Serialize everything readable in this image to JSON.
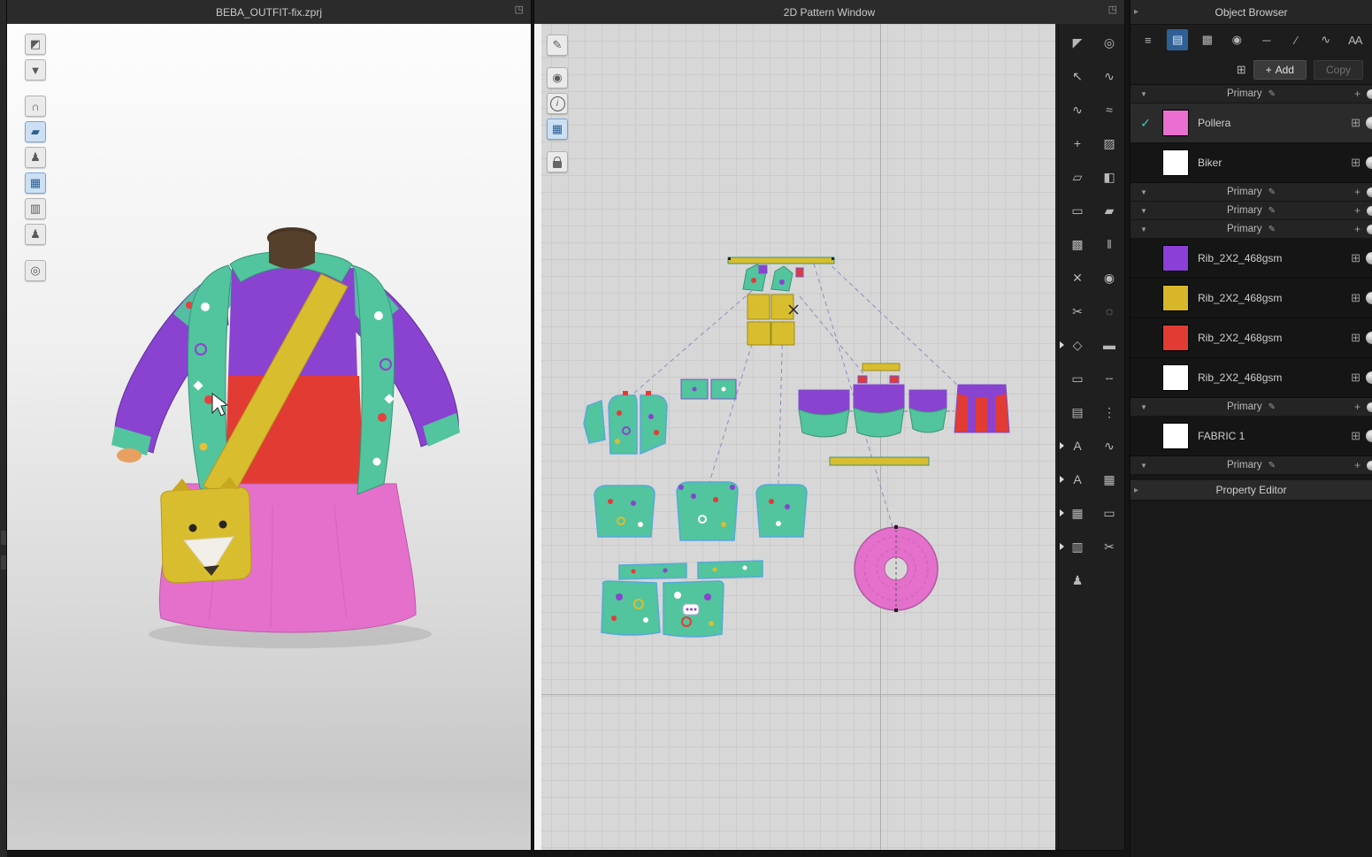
{
  "palette": {
    "pink": "#e470cc",
    "purple": "#8a42d0",
    "yellow": "#d8be2e",
    "red": "#e23b34",
    "teal": "#52c49e",
    "accent_blue": "#2e5f95"
  },
  "win3d": {
    "title": "BEBA_OUTFIT-fix.zprj"
  },
  "win2d": {
    "title": "2D Pattern Window"
  },
  "property_editor": {
    "title": "Property Editor"
  },
  "icons": {
    "popout": "◳",
    "panel_arrow": "▸",
    "check": "✓",
    "pencil": "✎",
    "collapse": "▼",
    "plus": "+",
    "boxed_plus": "⊞"
  },
  "toolbar3d": [
    {
      "name": "simulate",
      "glyph": "◩"
    },
    {
      "name": "garment-show",
      "glyph": "▼"
    },
    {
      "name": "hat-show",
      "glyph": "∩",
      "gap": true
    },
    {
      "name": "paint",
      "glyph": "▰",
      "active": true
    },
    {
      "name": "avatar-show",
      "glyph": "♟"
    },
    {
      "name": "fabric-on",
      "glyph": "▦",
      "active": true
    },
    {
      "name": "fabric-off",
      "glyph": "▥"
    },
    {
      "name": "avatar-edit",
      "glyph": "♟"
    },
    {
      "name": "world",
      "glyph": "◎",
      "gap": true
    }
  ],
  "toolbar2d": [
    {
      "name": "needle",
      "glyph": "✎"
    },
    {
      "name": "visibility",
      "glyph": "◉",
      "gap": true
    },
    {
      "name": "info",
      "glyph": "i",
      "circled": true
    },
    {
      "name": "fabric-2d",
      "glyph": "▦",
      "active": true
    },
    {
      "name": "lock",
      "glyph": "",
      "lock": true,
      "gap": true
    }
  ],
  "toolstrip_col1": [
    {
      "name": "transform-pattern",
      "glyph": "◤"
    },
    {
      "name": "edit-pattern",
      "glyph": "↖"
    },
    {
      "name": "edit-curvature",
      "glyph": "∿"
    },
    {
      "name": "add-point",
      "glyph": "+"
    },
    {
      "name": "folder",
      "glyph": "▱"
    },
    {
      "name": "image-panel",
      "glyph": "▭"
    },
    {
      "name": "texture-editor",
      "glyph": "▩"
    },
    {
      "name": "pin",
      "glyph": "✕"
    },
    {
      "name": "scissors",
      "glyph": "✂"
    },
    {
      "name": "polygon-pen",
      "glyph": "◇",
      "flyout": true
    },
    {
      "name": "rectangle",
      "glyph": "▭"
    },
    {
      "name": "ruler",
      "glyph": "▤"
    },
    {
      "name": "text",
      "glyph": "A",
      "flyout": true
    },
    {
      "name": "font",
      "glyph": "A",
      "flyout": true
    },
    {
      "name": "grid-layout",
      "glyph": "▦",
      "flyout": true
    },
    {
      "name": "pleat",
      "glyph": "▥",
      "flyout": true
    },
    {
      "name": "avatar-tool",
      "glyph": "♟"
    }
  ],
  "toolstrip_col2": [
    {
      "name": "zoom-pan",
      "glyph": "◎"
    },
    {
      "name": "segment-sew",
      "glyph": "∿"
    },
    {
      "name": "free-sew",
      "glyph": "≈"
    },
    {
      "name": "pattern-shade",
      "glyph": "▨"
    },
    {
      "name": "fold-arrangement",
      "glyph": "◧"
    },
    {
      "name": "flatten",
      "glyph": "▰"
    },
    {
      "name": "zipper",
      "glyph": "‖"
    },
    {
      "name": "button",
      "glyph": "◉"
    },
    {
      "name": "buttonhole",
      "glyph": "◌"
    },
    {
      "name": "seam-tape",
      "glyph": "▬"
    },
    {
      "name": "baste",
      "glyph": "╌"
    },
    {
      "name": "notch",
      "glyph": "⋮"
    },
    {
      "name": "puckering",
      "glyph": "∿"
    },
    {
      "name": "measure-grid",
      "glyph": "▦"
    },
    {
      "name": "annotation",
      "glyph": "▭"
    },
    {
      "name": "pattern-scissors",
      "glyph": "✂"
    }
  ],
  "object_browser": {
    "title": "Object Browser",
    "toolbar": [
      {
        "name": "list-view",
        "glyph": "≡"
      },
      {
        "name": "fabric-tab",
        "glyph": "▤",
        "active": true
      },
      {
        "name": "texture-tab",
        "glyph": "▩"
      },
      {
        "name": "button-tab",
        "glyph": "◉"
      },
      {
        "name": "trim-tab",
        "glyph": "─"
      },
      {
        "name": "topstitch-tab",
        "glyph": "∕"
      },
      {
        "name": "stitch-tab",
        "glyph": "∿"
      },
      {
        "name": "aa-tab",
        "glyph": "AA"
      }
    ],
    "actions": {
      "add": "Add",
      "copy": "Copy"
    },
    "rows": [
      {
        "kind": "group",
        "label": "Primary"
      },
      {
        "kind": "fabric",
        "label": "Pollera",
        "swatch": "#ea6fd0",
        "checked": true,
        "selected": true
      },
      {
        "kind": "fabric",
        "label": "Biker",
        "swatch": "#ffffff"
      },
      {
        "kind": "group",
        "label": "Primary"
      },
      {
        "kind": "group",
        "label": "Primary"
      },
      {
        "kind": "group",
        "label": "Primary"
      },
      {
        "kind": "fabric",
        "label": "Rib_2X2_468gsm",
        "swatch": "#8a3fd6"
      },
      {
        "kind": "fabric",
        "label": "Rib_2X2_468gsm",
        "swatch": "#d8b62a"
      },
      {
        "kind": "fabric",
        "label": "Rib_2X2_468gsm",
        "swatch": "#e23b34"
      },
      {
        "kind": "fabric",
        "label": "Rib_2X2_468gsm",
        "swatch": "#ffffff"
      },
      {
        "kind": "group",
        "label": "Primary"
      },
      {
        "kind": "fabric",
        "label": "FABRIC 1",
        "swatch": "#ffffff"
      },
      {
        "kind": "group",
        "label": "Primary"
      }
    ]
  }
}
